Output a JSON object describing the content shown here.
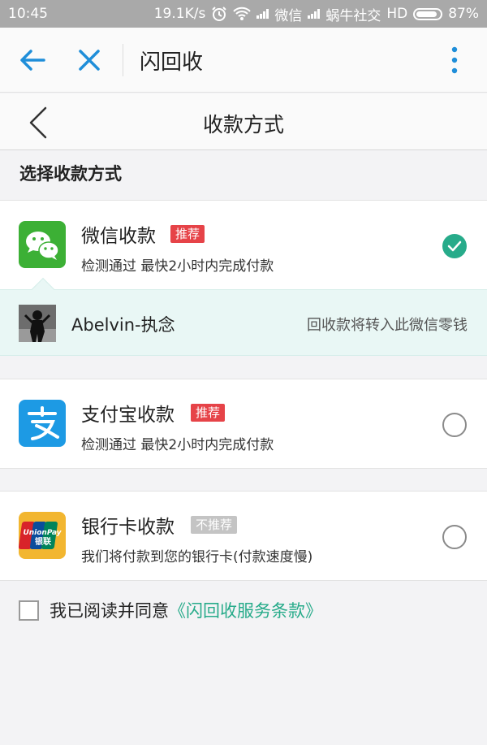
{
  "status_bar": {
    "time": "10:45",
    "speed": "19.1K/s",
    "carrier1": "微信",
    "carrier2": "蜗牛社交",
    "hd": "HD",
    "battery": "87%",
    "battery_level": 0.87
  },
  "browser": {
    "title": "闪回收"
  },
  "page": {
    "title": "收款方式",
    "section_title": "选择收款方式"
  },
  "options": [
    {
      "name": "微信收款",
      "tag": "推荐",
      "tag_color": "#e64348",
      "subtitle": "检测通过 最快2小时内完成付款",
      "selected": true
    },
    {
      "name": "支付宝收款",
      "tag": "推荐",
      "tag_color": "#e64348",
      "subtitle": "检测通过 最快2小时内完成付款",
      "selected": false
    },
    {
      "name": "银行卡收款",
      "tag": "不推荐",
      "tag_color": "#c4c4c4",
      "subtitle": "我们将付款到您的银行卡(付款速度慢)",
      "selected": false
    }
  ],
  "account": {
    "name": "Abelvin-执念",
    "note": "回收款将转入此微信零钱"
  },
  "bank_logo": {
    "line1": "UnionPay",
    "line2": "银联"
  },
  "agreement": {
    "text": "我已阅读并同意",
    "link": "《闪回收服务条款》"
  },
  "colors": {
    "accent": "#27ab8a",
    "browser_icon": "#1f8ed9",
    "recommend_tag": "#e64348"
  }
}
